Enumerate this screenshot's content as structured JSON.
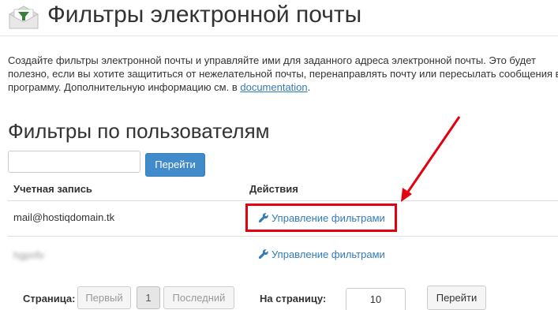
{
  "header": {
    "title": "Фильтры электронной почты",
    "icon": "email-filter-icon"
  },
  "description": {
    "line1": "Создайте фильтры электронной почты и управляйте ими для заданного адреса электронной почты. Это будет",
    "line2": "полезно, если вы хотите защититься от нежелательной почты, перенаправлять почту или пересылать сообщения в",
    "line3_prefix": "программу. Дополнительную информацию см. в ",
    "link": "documentation",
    "line3_suffix": "."
  },
  "section": {
    "title": "Фильтры по пользователям"
  },
  "search": {
    "value": "",
    "placeholder": "",
    "button_label": "Перейти"
  },
  "table": {
    "headers": [
      "Учетная запись",
      "Действия"
    ],
    "rows": [
      {
        "account": "mail@hostiqdomain.tk",
        "action": "Управление фильтрами"
      },
      {
        "account": "hgpnfv",
        "action": "Управление фильтрами"
      }
    ]
  },
  "pagination": {
    "page_label": "Страница:",
    "first": "Первый",
    "current": "1",
    "last": "Последний",
    "per_page_label": "На страницу:",
    "per_page_value": "10",
    "go_label": "Перейти"
  },
  "colors": {
    "primary_button": "#428bca",
    "link": "#337ab7",
    "highlight": "#e3000f"
  }
}
